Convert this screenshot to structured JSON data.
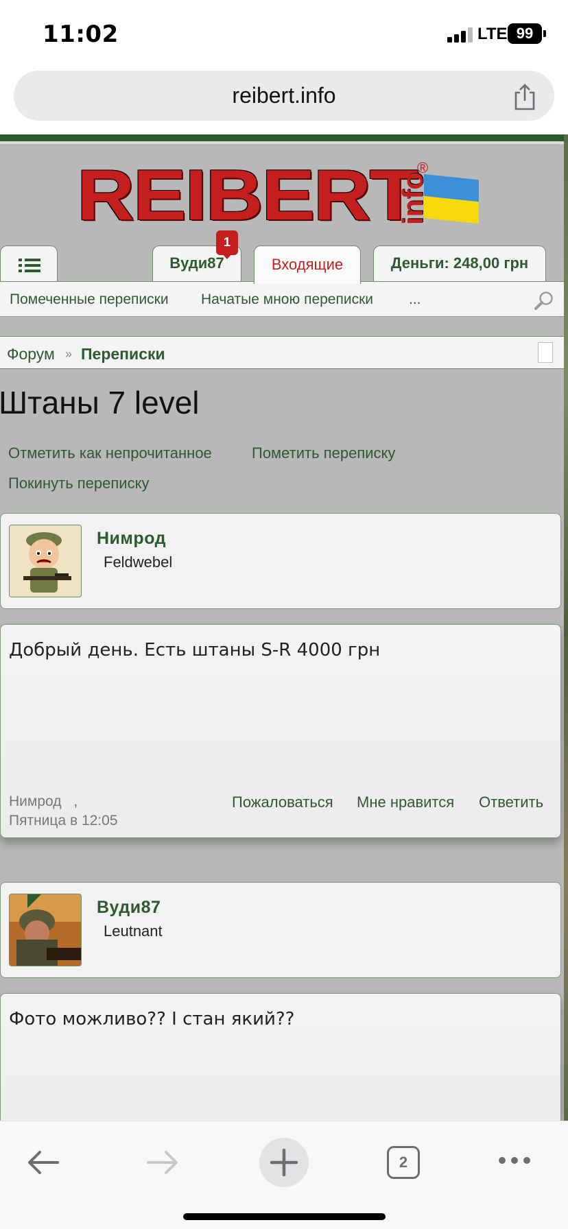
{
  "status": {
    "time": "11:02",
    "network": "LTE",
    "battery": "99"
  },
  "browser": {
    "url": "reibert.info",
    "tabs_count": "2"
  },
  "site": {
    "logo": "REIBERT",
    "logo_suffix": "info",
    "logo_reg": "®",
    "nav": {
      "user_tab": "Вуди87",
      "user_badge": "1",
      "inbox_tab": "Входящие",
      "money_tab": "Деньги: 248,00 грн"
    },
    "subnav": {
      "marked": "Помеченные переписки",
      "started": "Начатые мною переписки",
      "more": "..."
    },
    "breadcrumb": {
      "forum": "Форум",
      "sep": "»",
      "current": "Переписки"
    },
    "title": "Штаны 7 level",
    "actions": {
      "mark_unread": "Отметить как непрочитанное",
      "mark_conv": "Пометить переписку",
      "leave": "Покинуть переписку"
    },
    "messages": [
      {
        "author": "Нимрод",
        "rank": "Feldwebel",
        "text": "Добрый день. Есть штаны S-R 4000 грн",
        "meta_author": "Нимрод",
        "meta_sep": ",",
        "meta_date": "Пятница в 12:05",
        "report": "Пожаловаться",
        "like": "Мне нравится",
        "reply": "Ответить"
      },
      {
        "author": "Вуди87",
        "rank": "Leutnant",
        "text": "Фото можливо?? І стан який??"
      }
    ]
  },
  "colors": {
    "accent_green": "#2d5a2f",
    "brand_red": "#c41e1e",
    "page_bg": "#b8b8b8"
  }
}
